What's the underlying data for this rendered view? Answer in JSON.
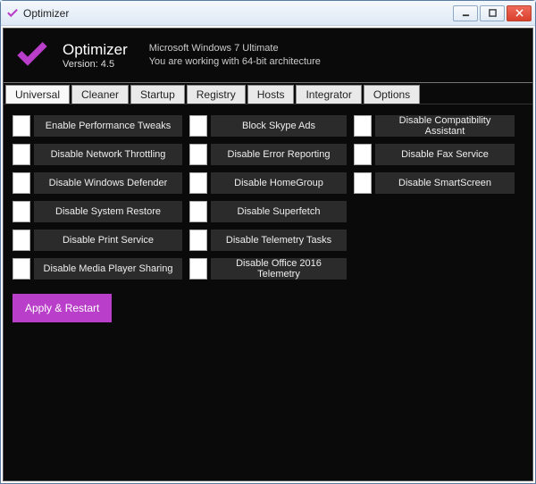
{
  "window": {
    "title": "Optimizer"
  },
  "header": {
    "app_name": "Optimizer",
    "version_label": "Version: 4.5",
    "os_line": "Microsoft Windows 7 Ultimate",
    "arch_line": "You are working with 64-bit architecture"
  },
  "tabs": {
    "t0": "Universal",
    "t1": "Cleaner",
    "t2": "Startup",
    "t3": "Registry",
    "t4": "Hosts",
    "t5": "Integrator",
    "t6": "Options"
  },
  "options": {
    "c1": {
      "o0": "Enable Performance Tweaks",
      "o1": "Disable Network Throttling",
      "o2": "Disable Windows Defender",
      "o3": "Disable System Restore",
      "o4": "Disable Print Service",
      "o5": "Disable Media Player Sharing"
    },
    "c2": {
      "o0": "Block Skype Ads",
      "o1": "Disable Error Reporting",
      "o2": "Disable HomeGroup",
      "o3": "Disable Superfetch",
      "o4": "Disable Telemetry Tasks",
      "o5": "Disable Office 2016 Telemetry"
    },
    "c3": {
      "o0": "Disable Compatibility Assistant",
      "o1": "Disable Fax Service",
      "o2": "Disable SmartScreen"
    }
  },
  "buttons": {
    "apply": "Apply & Restart"
  },
  "colors": {
    "accent": "#b93ec9"
  }
}
